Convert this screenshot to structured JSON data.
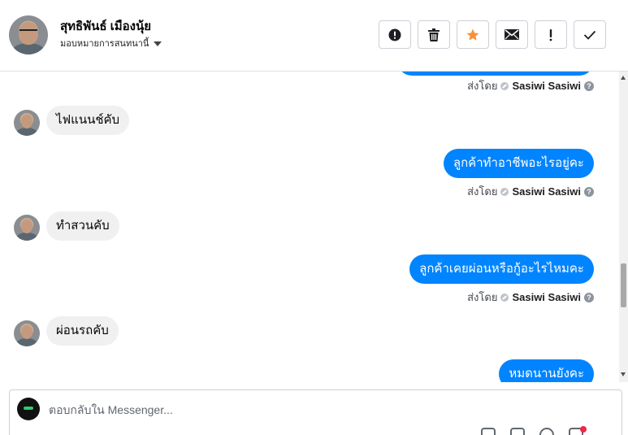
{
  "header": {
    "contact_name": "สุทธิพันธ์ เมืองนุ้ย",
    "assign_label": "มอบหมายการสนทนานี้"
  },
  "toolbar": [
    {
      "name": "report-button",
      "icon": "exclamation-circle-icon"
    },
    {
      "name": "delete-button",
      "icon": "trash-icon"
    },
    {
      "name": "star-button",
      "icon": "star-icon",
      "color": "#f7923b"
    },
    {
      "name": "mark-unread-button",
      "icon": "envelope-icon"
    },
    {
      "name": "follow-up-button",
      "icon": "exclamation-icon"
    },
    {
      "name": "mark-done-button",
      "icon": "checkmark-icon"
    }
  ],
  "messages": [
    {
      "direction": "outgoing",
      "text": "",
      "partial": true,
      "sent_by_label": "ส่งโดย",
      "sender": "Sasiwi Sasiwi"
    },
    {
      "direction": "incoming",
      "text": "ไฟแนนช์คับ"
    },
    {
      "direction": "outgoing",
      "text": "ลูกค้าทำอาชีพอะไรอยู่คะ",
      "sent_by_label": "ส่งโดย",
      "sender": "Sasiwi Sasiwi"
    },
    {
      "direction": "incoming",
      "text": "ทำสวนคับ"
    },
    {
      "direction": "outgoing",
      "text": "ลูกค้าเคยผ่อนหรือกู้อะไรไหมคะ",
      "sent_by_label": "ส่งโดย",
      "sender": "Sasiwi Sasiwi"
    },
    {
      "direction": "incoming",
      "text": "ผ่อนรถคับ"
    },
    {
      "direction": "outgoing",
      "text": "หมดนานยังคะ",
      "partial": true
    }
  ],
  "composer": {
    "placeholder": "ตอบกลับใน Messenger..."
  },
  "colors": {
    "outgoing_bubble": "#0084ff",
    "incoming_bubble": "#f0f0f0",
    "star_accent": "#f7923b",
    "notification_dot": "#f02849"
  }
}
